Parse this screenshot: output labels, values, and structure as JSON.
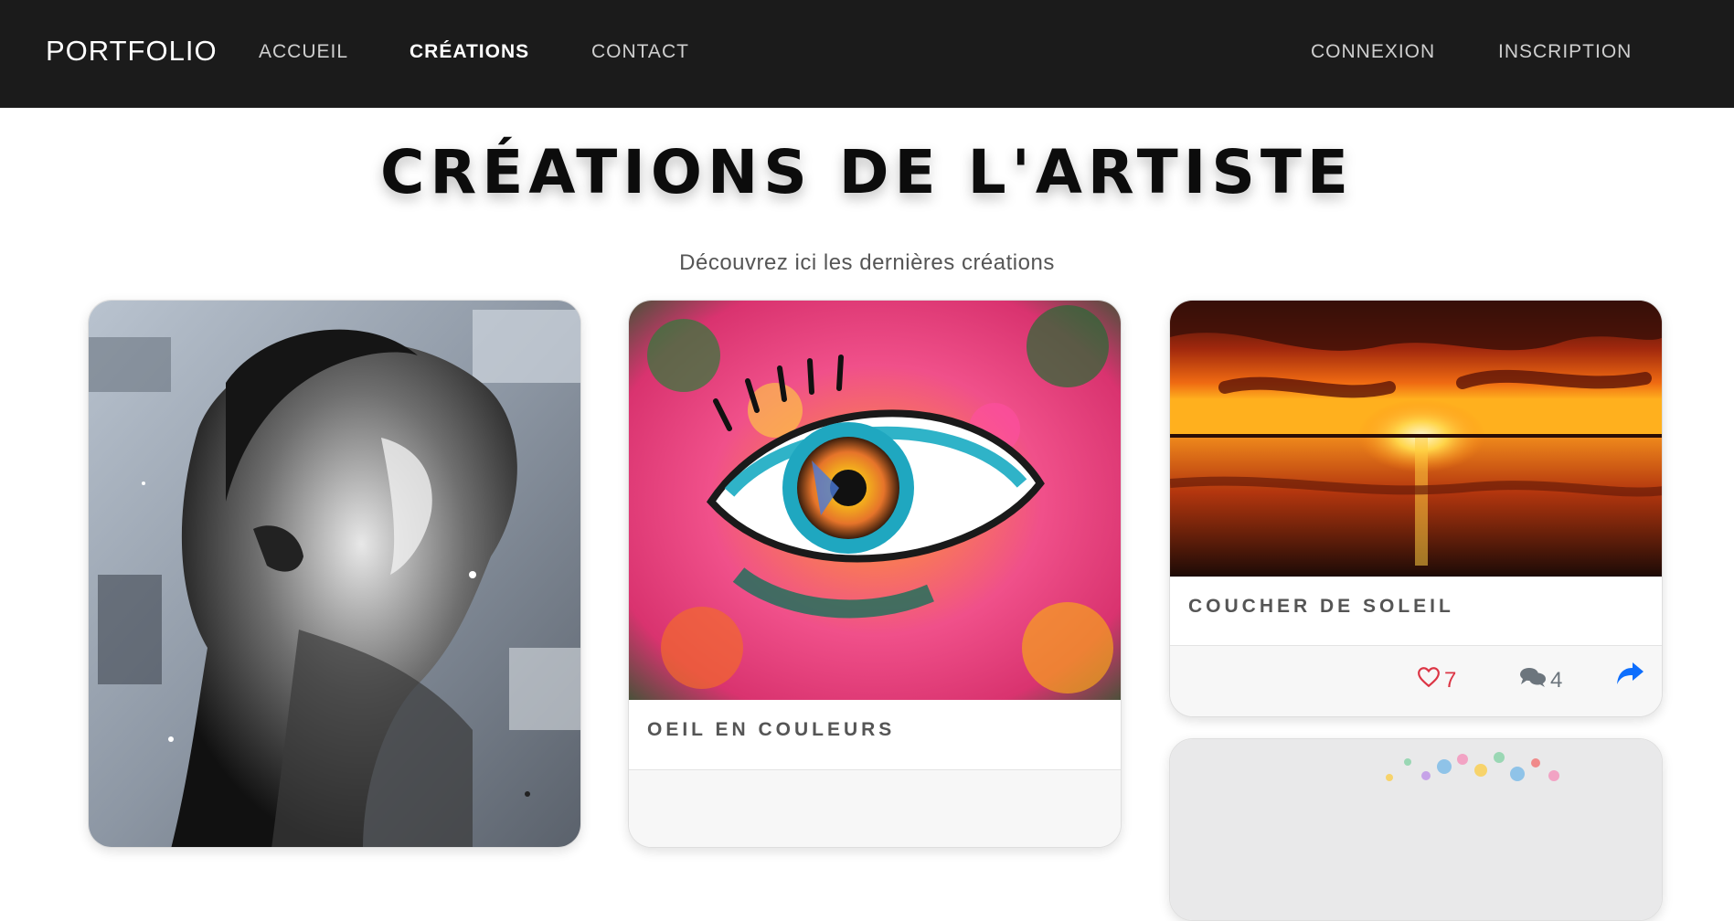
{
  "navbar": {
    "brand": "PORTFOLIO",
    "links": [
      {
        "label": "ACCUEIL",
        "active": false
      },
      {
        "label": "CRÉATIONS",
        "active": true
      },
      {
        "label": "CONTACT",
        "active": false
      }
    ],
    "auth": [
      {
        "label": "CONNEXION"
      },
      {
        "label": "INSCRIPTION"
      }
    ]
  },
  "header": {
    "title": "CRÉATIONS DE L'ARTISTE",
    "subtitle": "Découvrez ici les dernières créations"
  },
  "creations": [
    {
      "title": "",
      "image": "grayscale-portrait-painting-thumbnail"
    },
    {
      "title": "OEIL EN COULEURS",
      "image": "colorful-eye-painting-thumbnail"
    },
    {
      "title": "COUCHER DE SOLEIL",
      "image": "sunset-lake-photo-thumbnail",
      "likes": "7",
      "comments": "4"
    },
    {
      "title": "",
      "image": "pastel-confetti-artwork-thumbnail"
    }
  ],
  "icons": {
    "like": "heart-icon",
    "comment": "comments-icon",
    "share": "share-icon"
  },
  "colors": {
    "navbar_bg": "#1b1b1b",
    "like": "#dc3545",
    "share": "#0d6efd",
    "muted": "#6c757d"
  }
}
